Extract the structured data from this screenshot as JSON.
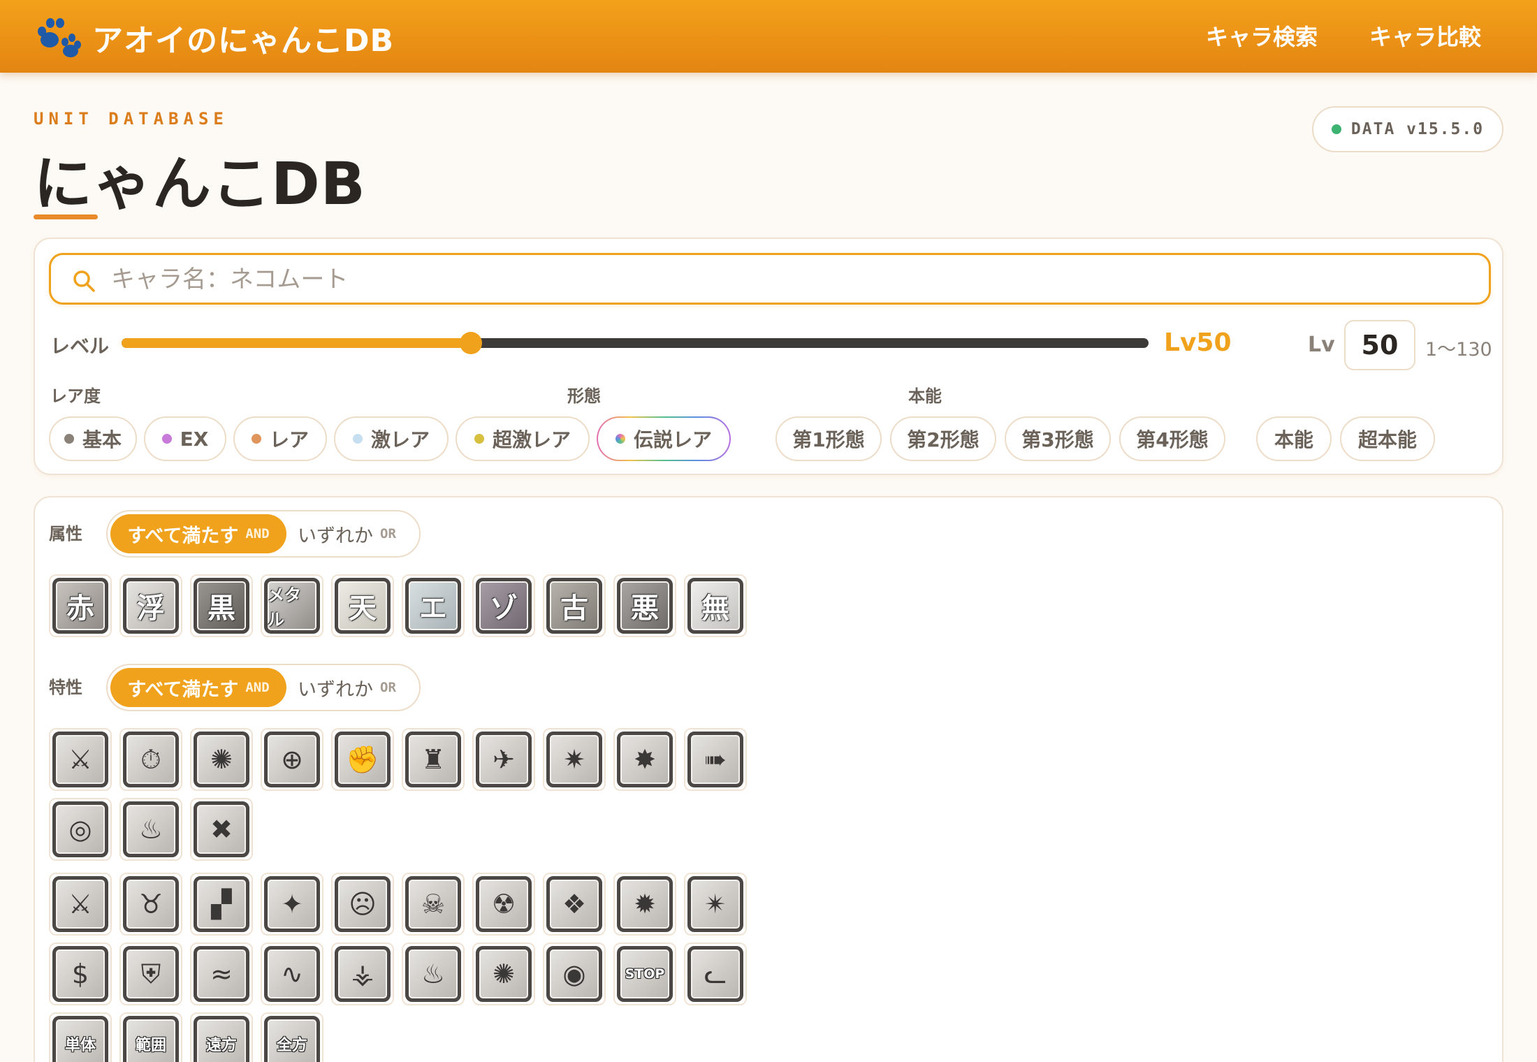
{
  "header": {
    "brand": "アオイのにゃんこDB",
    "nav": [
      "キャラ検索",
      "キャラ比較"
    ]
  },
  "title": {
    "eyebrow": "UNIT DATABASE",
    "main": "にゃんこDB",
    "version": "DATA v15.5.0"
  },
  "search": {
    "placeholder": "キャラ名：ネコムート",
    "value": ""
  },
  "level": {
    "label": "レベル",
    "readout": "Lv50",
    "input_label": "Lv",
    "value": "50",
    "range": "1〜130",
    "fraction": 0.34
  },
  "filters": {
    "rarity": {
      "label": "レア度",
      "items": [
        {
          "label": "基本",
          "color": "#8a8178"
        },
        {
          "label": "EX",
          "color": "#c77ad8"
        },
        {
          "label": "レア",
          "color": "#e0955c"
        },
        {
          "label": "激レア",
          "color": "#c6dff0"
        },
        {
          "label": "超激レア",
          "color": "#d6c03e"
        },
        {
          "label": "伝説レア",
          "color": "gradient"
        }
      ]
    },
    "form": {
      "label": "形態",
      "items": [
        "第1形態",
        "第2形態",
        "第3形態",
        "第4形態"
      ]
    },
    "talent": {
      "label": "本能",
      "items": [
        "本能",
        "超本能"
      ]
    }
  },
  "attribute": {
    "label": "属性",
    "and_label": "すべて満たす",
    "and_tag": "AND",
    "or_label": "いずれか",
    "or_tag": "OR",
    "icons": [
      {
        "name": "red",
        "text": "赤"
      },
      {
        "name": "floating",
        "text": "浮"
      },
      {
        "name": "black",
        "text": "黒"
      },
      {
        "name": "metal",
        "text": "メタル"
      },
      {
        "name": "angel",
        "text": "天"
      },
      {
        "name": "alien",
        "text": "エ"
      },
      {
        "name": "zombie",
        "text": "ゾ"
      },
      {
        "name": "relic",
        "text": "古"
      },
      {
        "name": "aku",
        "text": "悪"
      },
      {
        "name": "traitless",
        "text": "無"
      }
    ]
  },
  "ability": {
    "label": "特性",
    "and_label": "すべて満たす",
    "and_tag": "AND",
    "or_label": "いずれか",
    "or_tag": "OR",
    "row1": [
      "sword-icon",
      "stopwatch-icon",
      "burst-figure-icon",
      "target-icon",
      "fist-icon",
      "armor-icon",
      "cannon-icon",
      "shockwave-icon",
      "shatter-icon",
      "knockback-icon"
    ],
    "row2": [
      "vortex-icon",
      "flame-icon",
      "explosion-cross-icon"
    ],
    "row3": [
      "sword-up-icon",
      "muscle-icon",
      "crumble-icon",
      "stars-icon",
      "demon-face-icon",
      "skull-icon",
      "zombie-icon",
      "barrier-icon",
      "shield-break-icon",
      "strike-icon"
    ],
    "row4": [
      "money-bag-icon",
      "cat-shield-icon",
      "wave-low-icon",
      "wave-mid-icon",
      "fire-ring-icon",
      "fire-icon",
      "blast-icon",
      "target-fire-icon",
      "stop-icon",
      "cat-face-icon"
    ],
    "row5": [
      {
        "name": "single-target",
        "text": "単体"
      },
      {
        "name": "area-attack",
        "text": "範囲"
      },
      {
        "name": "long-distance",
        "text": "遠方"
      },
      {
        "name": "omni-strike",
        "text": "全方"
      }
    ],
    "stop_text": "STOP"
  }
}
